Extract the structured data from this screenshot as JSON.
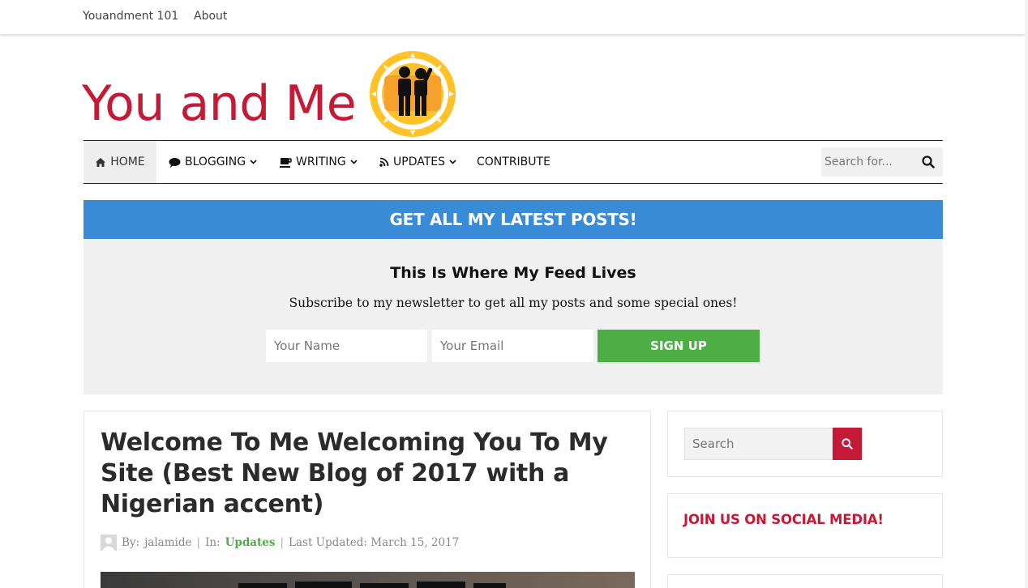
{
  "topnav": {
    "items": [
      {
        "label": "Youandment 101"
      },
      {
        "label": "About"
      }
    ]
  },
  "logo": {
    "text": "You and Me"
  },
  "mainnav": {
    "items": [
      {
        "label": "HOME",
        "icon": "home-icon"
      },
      {
        "label": "BLOGGING",
        "icon": "comment-icon",
        "dropdown": true
      },
      {
        "label": "WRITING",
        "icon": "coffee-icon",
        "dropdown": true
      },
      {
        "label": "UPDATES",
        "icon": "rss-icon",
        "dropdown": true
      },
      {
        "label": "CONTRIBUTE"
      }
    ],
    "search_placeholder": "Search for..."
  },
  "optin": {
    "banner": "GET ALL MY LATEST POSTS!",
    "title": "This Is Where My Feed Lives",
    "subtitle": "Subscribe to my newsletter to get all my posts and some special ones!",
    "name_placeholder": "Your Name",
    "email_placeholder": "Your Email",
    "button": "SIGN UP"
  },
  "article": {
    "title": "Welcome To Me Welcoming You To My Site (Best New Blog of 2017 with a Nigerian accent)",
    "by_label": "By:",
    "author": "jalamide",
    "in_label": "In:",
    "category": "Updates",
    "separator": "|",
    "updated": "Last Updated: March 15, 2017"
  },
  "sidebar": {
    "search_placeholder": "Search",
    "social_heading": "JOIN US ON SOCIAL MEDIA!"
  },
  "colors": {
    "brand_red": "#c41a37",
    "banner_blue": "#3a8bd6",
    "signup_green": "#4cae45",
    "category_green": "#4cae45"
  }
}
